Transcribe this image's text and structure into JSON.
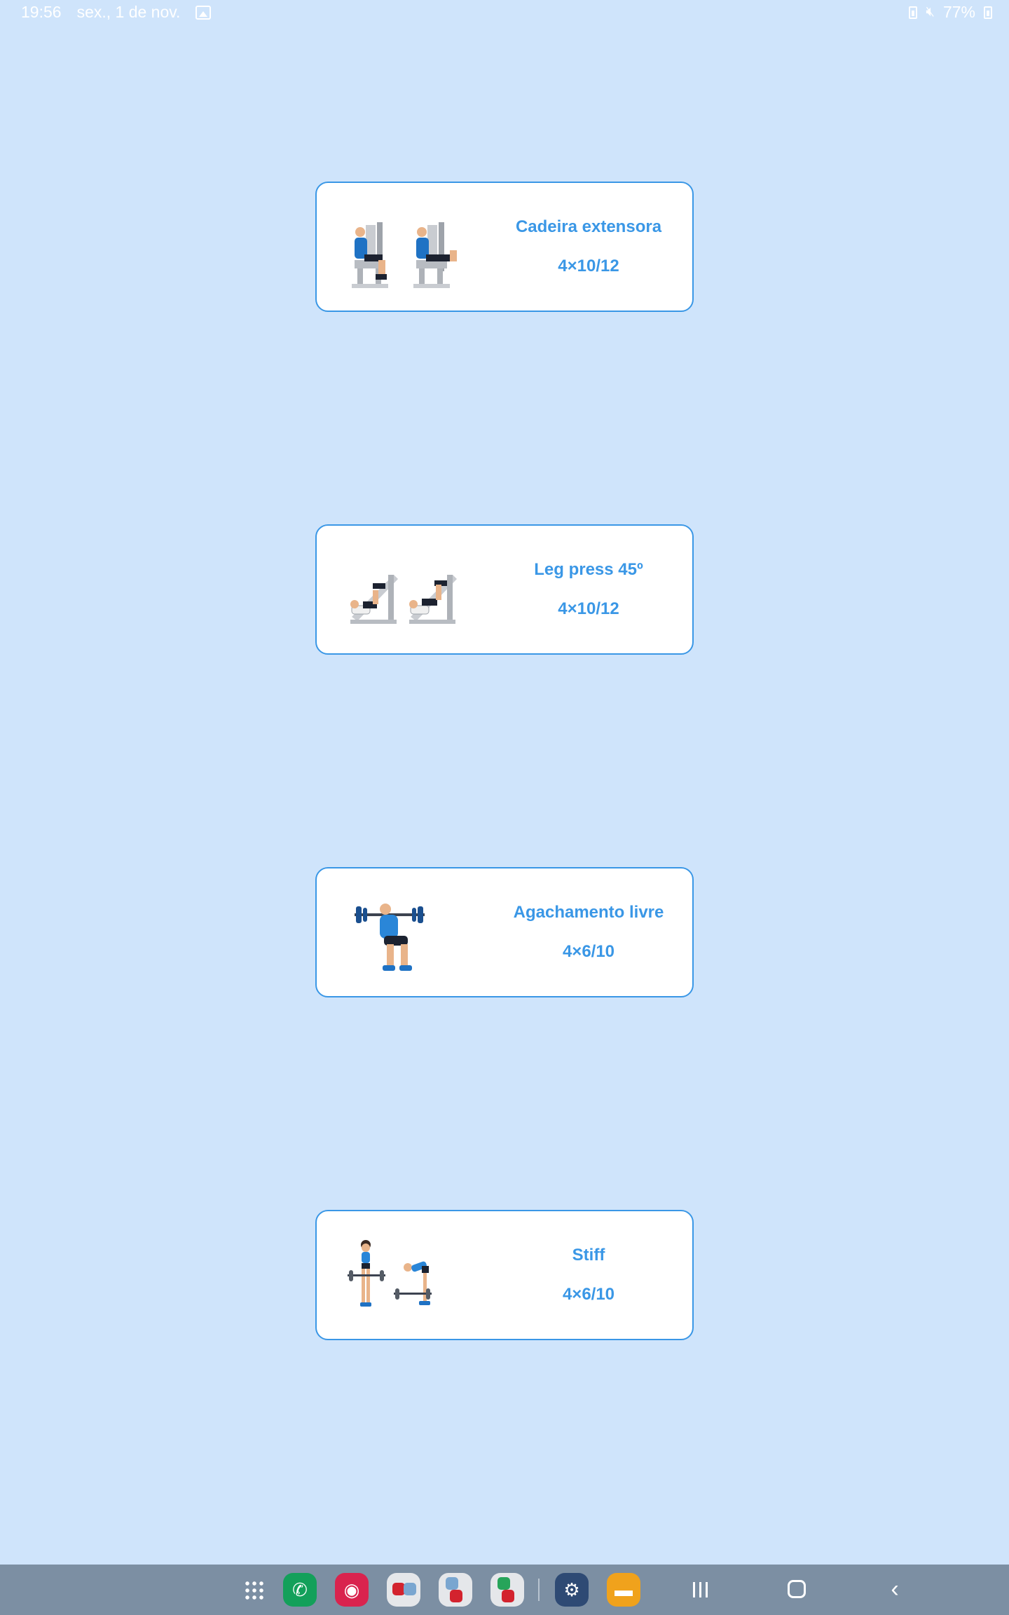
{
  "status_bar": {
    "time": "19:56",
    "date": "sex., 1 de nov.",
    "battery": "77%",
    "icons": [
      "gallery-icon",
      "battery-saver-icon",
      "mute-icon",
      "battery-icon"
    ]
  },
  "exercises": [
    {
      "title": "Cadeira extensora",
      "sets": "4×10/12",
      "figure": "leg-extension-machine-illustration"
    },
    {
      "title": "Leg press 45º",
      "sets": "4×10/12",
      "figure": "leg-press-machine-illustration"
    },
    {
      "title": "Agachamento livre",
      "sets": "4×6/10",
      "figure": "barbell-squat-illustration"
    },
    {
      "title": "Stiff",
      "sets": "4×6/10",
      "figure": "stiff-deadlift-illustration"
    }
  ],
  "colors": {
    "background": "#cfe4fb",
    "accent": "#3a97e6",
    "card": "#ffffff",
    "nav_bar": "#7c8fa3"
  },
  "nav_bar": {
    "apps": [
      "app-drawer-icon",
      "phone-app-icon",
      "camera-app-icon",
      "multi-window-icon",
      "multi-window-icon",
      "multi-window-icon",
      "settings-app-icon",
      "files-app-icon"
    ],
    "buttons": [
      "recents-icon",
      "home-icon",
      "back-icon"
    ]
  }
}
